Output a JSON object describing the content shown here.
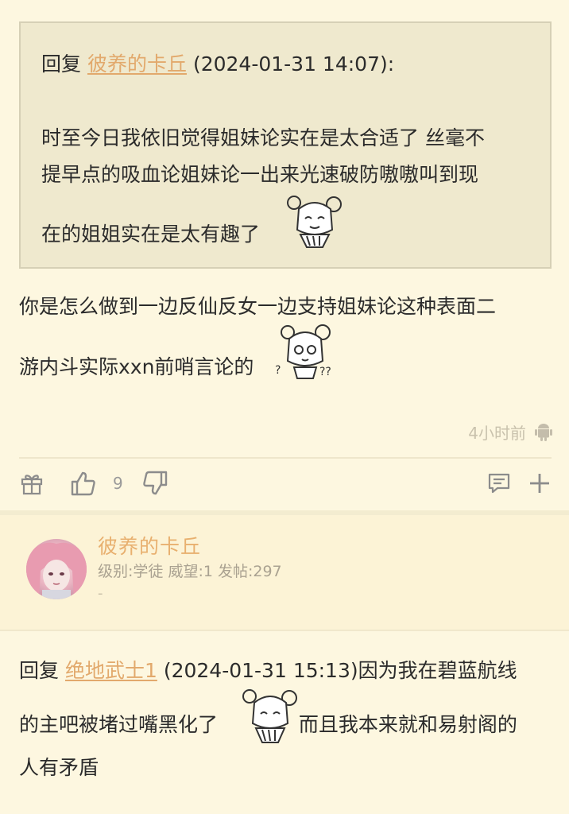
{
  "post": {
    "quote": {
      "reply_prefix": "回复",
      "username": "彼养的卡丘",
      "timestamp": "(2024-01-31 14:07):",
      "line1": "时至今日我依旧觉得姐妹论实在是太合适了 丝毫不",
      "line2": "提早点的吸血论姐妹论一出来光速破防嗷嗷叫到现",
      "line3": "在的姐姐实在是太有趣了"
    },
    "reply_line1": "你是怎么做到一边反仙反女一边支持姐妹论这种表面二",
    "reply_line2": "游内斗实际xxn前哨言论的",
    "time_ago": "4小时前",
    "platform_icon": "android-icon",
    "like_count": "9"
  },
  "user_card": {
    "name": "彼养的卡丘",
    "meta": "级别:学徒 威望:1 发帖:297",
    "signature": "-"
  },
  "post2": {
    "reply_prefix": "回复",
    "username": "绝地武士1",
    "line1_rest": "(2024-01-31 15:13)因为我在碧蓝航线",
    "line2a": "的主吧被堵过嘴黑化了",
    "line2b": "而且我本来就和易射阁的",
    "line3": "人有矛盾"
  },
  "colors": {
    "background": "#fdf7e0",
    "quote_bg": "#efe9ce",
    "username": "#e2a96c",
    "icon": "#9a9a9a"
  }
}
